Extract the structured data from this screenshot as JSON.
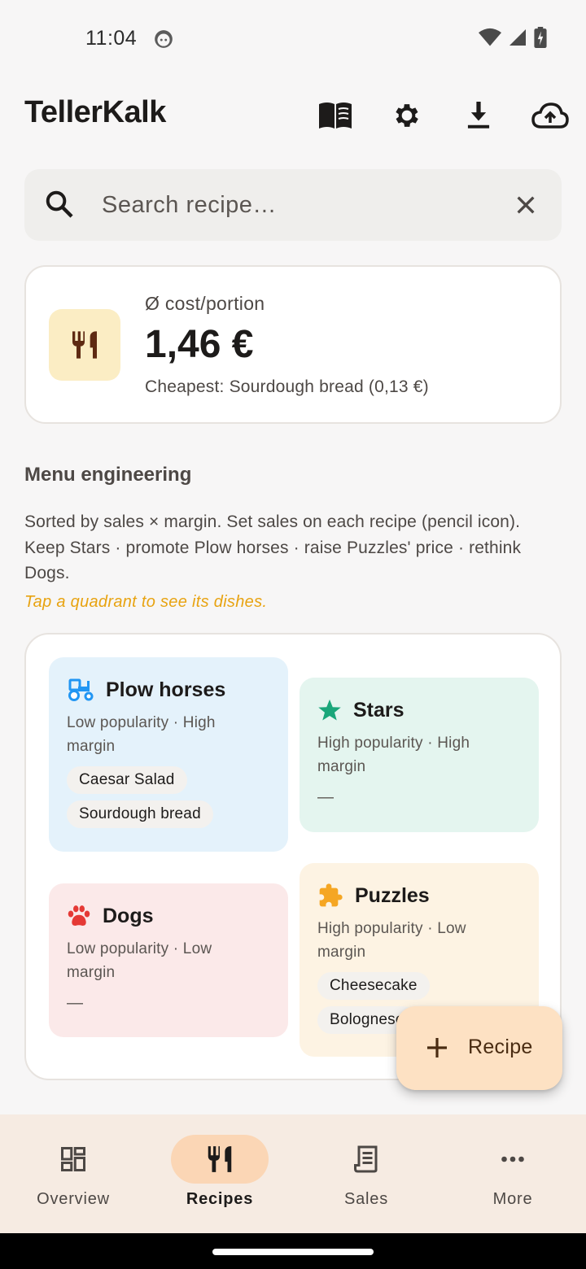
{
  "status_bar": {
    "time": "11:04"
  },
  "app_bar": {
    "title": "TellerKalk",
    "actions": [
      "menu-book-icon",
      "settings-icon",
      "download-icon",
      "cloud-upload-icon"
    ]
  },
  "search": {
    "placeholder": "Search recipe…",
    "value": ""
  },
  "cost_card": {
    "label": "Ø cost/portion",
    "value": "1,46 €",
    "cheapest": "Cheapest: Sourdough bread (0,13 €)"
  },
  "menu_engineering": {
    "title": "Menu engineering",
    "description": "Sorted by sales × margin. Set sales on each recipe (pencil icon). Keep Stars · promote Plow horses · raise Puzzles' price · rethink Dogs.",
    "hint": "Tap a quadrant to see its dishes.",
    "quadrants": {
      "plow_horses": {
        "title": "Plow horses",
        "description": "Low popularity · High margin",
        "dishes": [
          "Caesar Salad",
          "Sourdough bread"
        ],
        "color": "#e4f2fb",
        "icon": "tractor-icon"
      },
      "stars": {
        "title": "Stars",
        "description": "High popularity · High margin",
        "dishes": [],
        "empty": "—",
        "color": "#e4f5ef",
        "icon": "star-icon"
      },
      "dogs": {
        "title": "Dogs",
        "description": "Low popularity · Low margin",
        "dishes": [],
        "empty": "—",
        "color": "#fbe9e9",
        "icon": "paw-icon"
      },
      "puzzles": {
        "title": "Puzzles",
        "description": "High popularity · Low margin",
        "dishes": [
          "Cheesecake",
          "Bolognese"
        ],
        "color": "#fdf3e3",
        "icon": "puzzle-icon"
      }
    }
  },
  "fab": {
    "label": "Recipe"
  },
  "bottom_nav": {
    "items": [
      {
        "label": "Overview",
        "icon": "dashboard-icon",
        "active": false
      },
      {
        "label": "Recipes",
        "icon": "restaurant-icon",
        "active": true
      },
      {
        "label": "Sales",
        "icon": "receipt-icon",
        "active": false
      },
      {
        "label": "More",
        "icon": "more-horiz-icon",
        "active": false
      }
    ]
  },
  "colors": {
    "accent": "#fbd6b5",
    "fab": "#fde1c3",
    "hint": "#e8a311",
    "nav_bg": "#f6ebe2"
  }
}
